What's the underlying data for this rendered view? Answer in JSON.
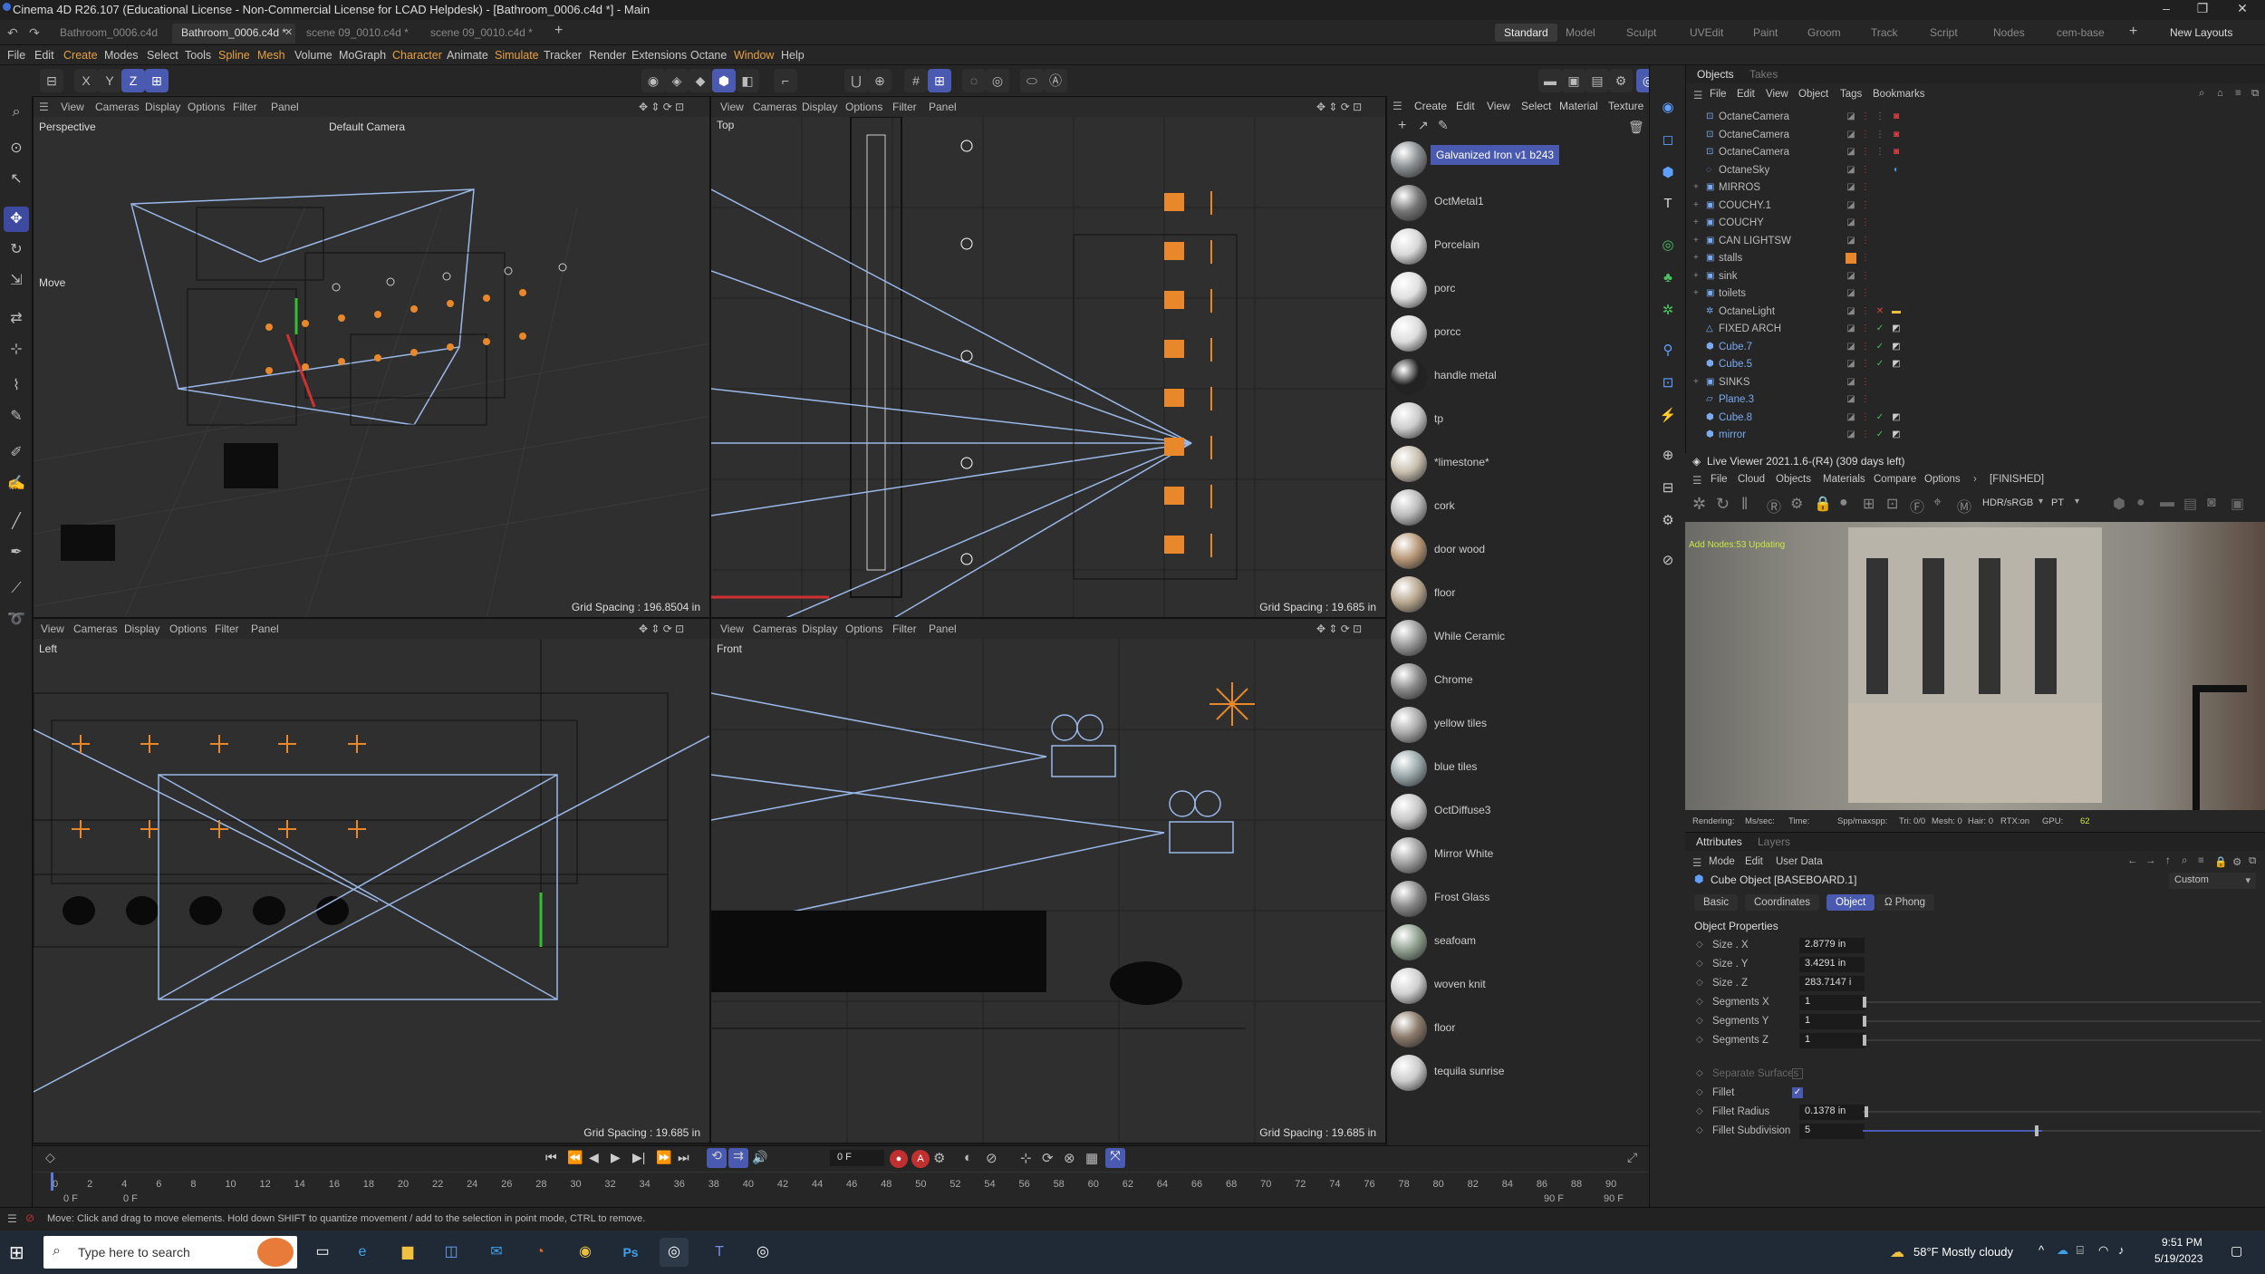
{
  "window": {
    "title": "Cinema 4D R26.107 (Educational License - Non-Commercial License for LCAD Helpdesk) - [Bathroom_0006.c4d *] - Main"
  },
  "doc_tabs": [
    {
      "label": "Bathroom_0006.c4d"
    },
    {
      "label": "Bathroom_0006.c4d *"
    },
    {
      "label": "scene 09_0010.c4d *"
    },
    {
      "label": "scene 09_0010.c4d *"
    }
  ],
  "layouts": [
    "Standard",
    "Model",
    "Sculpt",
    "UVEdit",
    "Paint",
    "Groom",
    "Track",
    "Script",
    "Nodes",
    "cem-base"
  ],
  "new_layouts": "New Layouts",
  "menu": [
    "File",
    "Edit",
    "Create",
    "Modes",
    "Select",
    "Tools",
    "Spline",
    "Mesh",
    "Volume",
    "MoGraph",
    "Character",
    "Animate",
    "Simulate",
    "Tracker",
    "Render",
    "Extensions",
    "Octane",
    "Window",
    "Help"
  ],
  "viewports": {
    "perspective": {
      "menu": [
        "View",
        "Cameras",
        "Display",
        "Options",
        "Filter",
        "Panel"
      ],
      "name": "Perspective",
      "camera": "Default Camera",
      "grid": "Grid Spacing : 196.8504 in",
      "mode": "Move"
    },
    "top": {
      "menu": [
        "View",
        "Cameras",
        "Display",
        "Options",
        "Filter",
        "Panel"
      ],
      "name": "Top",
      "grid": "Grid Spacing : 19.685 in"
    },
    "left": {
      "menu": [
        "View",
        "Cameras",
        "Display",
        "Options",
        "Filter",
        "Panel"
      ],
      "name": "Left",
      "grid": "Grid Spacing : 19.685 in"
    },
    "front": {
      "menu": [
        "View",
        "Cameras",
        "Display",
        "Options",
        "Filter",
        "Panel"
      ],
      "name": "Front",
      "grid": "Grid Spacing : 19.685 in"
    }
  },
  "materials": {
    "menu": [
      "Create",
      "Edit",
      "View",
      "Select",
      "Material",
      "Texture"
    ],
    "items": [
      {
        "name": "Galvanized Iron v1 b243",
        "color": "#8a8e90"
      },
      {
        "name": "OctMetal1",
        "color": "#777"
      },
      {
        "name": "Porcelain",
        "color": "#d8d8d8"
      },
      {
        "name": "porc",
        "color": "#e0e0e0"
      },
      {
        "name": "porcc",
        "color": "#dddddd"
      },
      {
        "name": "handle metal",
        "color": "#222"
      },
      {
        "name": "tp",
        "color": "#cccccc"
      },
      {
        "name": "*limestone*",
        "color": "#c8c0b0"
      },
      {
        "name": "cork",
        "color": "#bbb"
      },
      {
        "name": "door wood",
        "color": "#b89878"
      },
      {
        "name": "floor",
        "color": "#b8a890"
      },
      {
        "name": "While Ceramic",
        "color": "#999"
      },
      {
        "name": "Chrome",
        "color": "#8a8a8a"
      },
      {
        "name": "yellow tiles",
        "color": "#aaa"
      },
      {
        "name": "blue tiles",
        "color": "#9aa8aa"
      },
      {
        "name": "OctDiffuse3",
        "color": "#c8c8c8"
      },
      {
        "name": "Mirror White",
        "color": "#a0a0a0"
      },
      {
        "name": "Frost Glass",
        "color": "#888"
      },
      {
        "name": "seafoam",
        "color": "#90a090"
      },
      {
        "name": "woven knit",
        "color": "#d0d0d0"
      },
      {
        "name": "floor",
        "color": "#8a7a6a"
      },
      {
        "name": "tequila sunrise",
        "color": "#ccc"
      }
    ]
  },
  "objects": {
    "tabs": [
      "Objects",
      "Takes"
    ],
    "menu": [
      "File",
      "Edit",
      "View",
      "Object",
      "Tags",
      "Bookmarks"
    ],
    "rows": [
      {
        "name": "OctaneCamera",
        "icon": "camera-icon"
      },
      {
        "name": "OctaneCamera",
        "icon": "camera-icon"
      },
      {
        "name": "OctaneCamera",
        "icon": "camera-icon"
      },
      {
        "name": "OctaneSky",
        "icon": "sky-icon"
      },
      {
        "name": "MIRROS",
        "icon": "null-icon"
      },
      {
        "name": "COUCHY.1",
        "icon": "null-icon"
      },
      {
        "name": "COUCHY",
        "icon": "null-icon"
      },
      {
        "name": "CAN LIGHTSW",
        "icon": "null-icon"
      },
      {
        "name": "stalls",
        "icon": "null-icon"
      },
      {
        "name": "sink",
        "icon": "null-icon"
      },
      {
        "name": "toilets",
        "icon": "null-icon"
      },
      {
        "name": "OctaneLight",
        "icon": "light-icon"
      },
      {
        "name": "FIXED ARCH",
        "icon": "object-icon"
      },
      {
        "name": "Cube.7",
        "icon": "cube-icon"
      },
      {
        "name": "Cube.5",
        "icon": "cube-icon"
      },
      {
        "name": "SINKS",
        "icon": "null-icon"
      },
      {
        "name": "Plane.3",
        "icon": "plane-icon"
      },
      {
        "name": "Cube.8",
        "icon": "cube-icon"
      },
      {
        "name": "mirror",
        "icon": "cube-icon"
      }
    ]
  },
  "live_viewer": {
    "title": "Live Viewer 2021.1.6-(R4) (309 days left)",
    "menu": [
      "File",
      "Cloud",
      "Objects",
      "Materials",
      "Compare",
      "Options",
      "[FINISHED]"
    ],
    "colorspace": "HDR/sRGB",
    "kernel": "PT",
    "overlay": "Add Nodes:53  Updating",
    "stats": [
      "Rendering:",
      "Ms/sec:",
      "Time:",
      "Spp/maxspp:",
      "Tri: 0/0",
      "Mesh: 0",
      "Hair: 0",
      "RTX:on",
      "GPU:",
      "62"
    ]
  },
  "attributes": {
    "tabs": [
      "Attributes",
      "Layers"
    ],
    "menu": [
      "Mode",
      "Edit",
      "User Data"
    ],
    "object_title": "Cube Object [BASEBOARD.1]",
    "preset": "Custom",
    "subtabs": [
      "Basic",
      "Coordinates",
      "Object",
      "Phong"
    ],
    "section": "Object Properties",
    "props": [
      {
        "label": "Size . X",
        "value": "2.8779 in"
      },
      {
        "label": "Size . Y",
        "value": "3.4291 in"
      },
      {
        "label": "Size . Z",
        "value": "283.7147 i"
      },
      {
        "label": "Segments X",
        "value": "1"
      },
      {
        "label": "Segments Y",
        "value": "1"
      },
      {
        "label": "Segments Z",
        "value": "1"
      }
    ],
    "separate_surfaces": "Separate Surfaces",
    "fillet": "Fillet",
    "fillet_radius": {
      "label": "Fillet Radius",
      "value": "0.1378 in"
    },
    "fillet_subdivision": {
      "label": "Fillet Subdivision",
      "value": "5"
    }
  },
  "timeline": {
    "current_frame": "0 F",
    "ticks": [
      "0",
      "2",
      "4",
      "6",
      "8",
      "10",
      "12",
      "14",
      "16",
      "18",
      "20",
      "22",
      "24",
      "26",
      "28",
      "30",
      "32",
      "34",
      "36",
      "38",
      "40",
      "42",
      "44",
      "46",
      "48",
      "50",
      "52",
      "54",
      "56",
      "58",
      "60",
      "62",
      "64",
      "66",
      "68",
      "70",
      "72",
      "74",
      "76",
      "78",
      "80",
      "82",
      "84",
      "86",
      "88",
      "90"
    ],
    "start": "0 F",
    "start2": "0 F",
    "end": "90 F",
    "end2": "90 F"
  },
  "status": "Move: Click and drag to move elements. Hold down SHIFT to quantize movement / add to the selection in point mode, CTRL to remove.",
  "taskbar": {
    "search_placeholder": "Type here to search",
    "weather": "58°F  Mostly cloudy",
    "time": "9:51 PM",
    "date": "5/19/2023"
  }
}
